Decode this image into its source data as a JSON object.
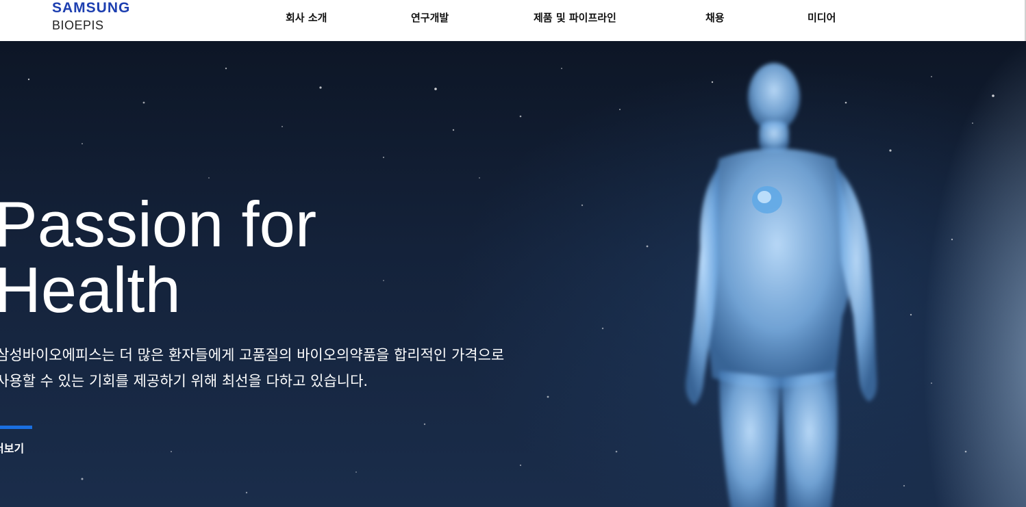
{
  "header": {
    "logo": {
      "line1": "SAMSUNG",
      "line2": "BIOEPIS",
      "color": "#1d3fb0"
    },
    "nav": [
      {
        "label": "회사 소개"
      },
      {
        "label": "연구개발"
      },
      {
        "label": "제품 및 파이프라인"
      },
      {
        "label": "채용"
      },
      {
        "label": "미디어"
      }
    ]
  },
  "hero": {
    "title": "Passion for\nHealth",
    "description": "삼성바이오에피스는 더 많은 환자들에게 고품질의 바이오의약품을 합리적인 가격으로 사용할 수 있는 기회를 제공하기 위해 최선을 다하고 있습니다.",
    "more_label": "더보기",
    "accent_color": "#1a6fe0"
  }
}
